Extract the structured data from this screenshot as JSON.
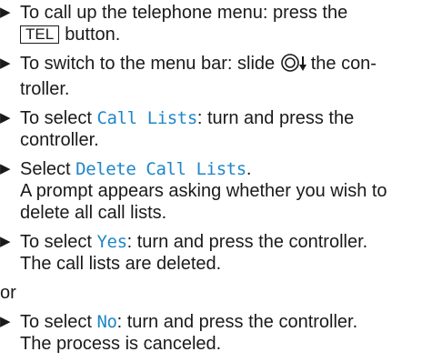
{
  "icons": {
    "bullet": "right-triangle-bullet",
    "controller": "controller-slide-down-icon"
  },
  "colors": {
    "menu_text": "#1e86c9",
    "body_text": "#1a1a1a"
  },
  "steps": [
    {
      "pre": "To call up the telephone menu: press the",
      "button": "TEL",
      "post": "button."
    },
    {
      "pre": "To switch to the menu bar: slide",
      "post": "the con-troller."
    },
    {
      "pre": "To select",
      "menu": "Call Lists",
      "post": ": turn and press the controller."
    },
    {
      "pre": "Select",
      "menu": "Delete Call Lists",
      "post": ".",
      "result": "A prompt appears asking whether you wish to delete all call lists."
    },
    {
      "pre": "To select",
      "menu": "Yes",
      "post": ": turn and press the controller.",
      "result": "The call lists are deleted."
    }
  ],
  "or_text": "or",
  "alt_step": {
    "pre": "To select",
    "menu": "No",
    "post": ": turn and press the controller.",
    "result": "The process is canceled."
  }
}
